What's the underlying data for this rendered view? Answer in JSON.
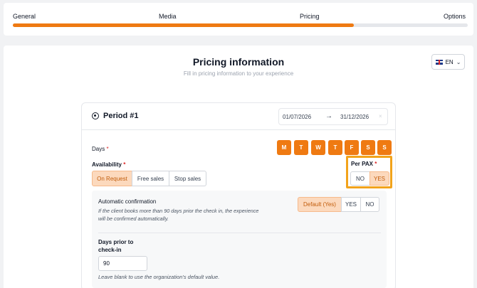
{
  "wizard": {
    "steps": [
      "General",
      "Media",
      "Pricing",
      "Options"
    ],
    "progress_percent": 75
  },
  "header": {
    "title": "Pricing information",
    "subtitle": "Fill in pricing information to your experience",
    "language": "EN"
  },
  "period": {
    "title": "Period #1",
    "start_date": "01/07/2026",
    "end_date": "31/12/2026",
    "arrow": "→",
    "clear": "×"
  },
  "days": {
    "label": "Days",
    "required_mark": "*",
    "items": [
      "M",
      "T",
      "W",
      "T",
      "F",
      "S",
      "S"
    ]
  },
  "availability": {
    "label": "Availability",
    "required_mark": "*",
    "options": [
      "On Request",
      "Free sales",
      "Stop sales"
    ],
    "selected": "On Request"
  },
  "per_pax": {
    "label": "Per PAX",
    "required_mark": "*",
    "options": [
      "NO",
      "YES"
    ],
    "selected": "YES"
  },
  "auto_confirmation": {
    "label": "Automatic confirmation",
    "description": "If the client books more than 90 days prior the check in, the experience will be confirmed automatically.",
    "options": [
      "Default (Yes)",
      "YES",
      "NO"
    ],
    "selected": "Default (Yes)"
  },
  "days_prior": {
    "label": "Days prior to check-in",
    "value": "90",
    "help": "Leave blank to use the organization's default value."
  },
  "colors": {
    "accent": "#ef7a12",
    "highlight": "#f2a31b",
    "selected_bg": "#fcd9bd"
  }
}
